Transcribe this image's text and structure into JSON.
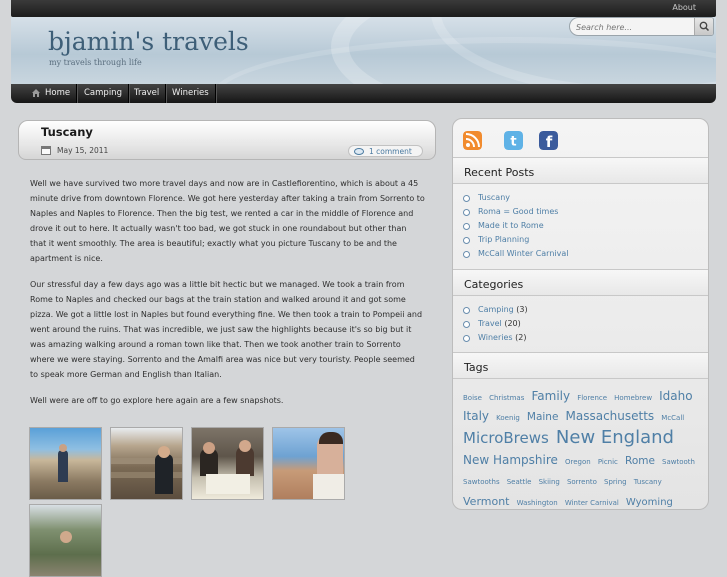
{
  "topbar": {
    "about": "About"
  },
  "header": {
    "title": "bjamin's travels",
    "tagline": "my travels through life"
  },
  "search": {
    "placeholder": "Search here..."
  },
  "nav": {
    "items": [
      "Home",
      "Camping",
      "Travel",
      "Wineries"
    ]
  },
  "post": {
    "title": "Tuscany",
    "date": "May 15, 2011",
    "comments": "1 comment",
    "paragraphs": [
      "Well we have survived two more travel days and now are in Castlefiorentino, which is about a 45 minute drive from downtown Florence. We got here yesterday after taking a train from Sorrento to Naples and Naples to Florence. Then the big test, we rented a car in the middle of Florence and drove it out to here. It actually wasn't too bad, we got stuck in one roundabout but other than that it went smoothly. The area is beautiful; exactly what you picture Tuscany to be and the apartment is nice.",
      "Our stressful day a few days ago was a little bit hectic but we managed. We took a train from Rome to Naples and checked our bags at the train station and walked around it and got some pizza. We got a little lost in Naples but found everything fine. We then took a train to Pompeii and went around the ruins. That was incredible, we just saw the highlights because it's so big but it was amazing walking around a roman town like that. Then we took another train to Sorrento where we were staying. Sorrento and the Amalfi area was nice but very touristy. People seemed to speak more German and English than Italian.",
      "Well were are off to go explore here again are a few snapshots."
    ]
  },
  "sidebar": {
    "social": [
      "rss-icon",
      "twitter-icon",
      "facebook-icon"
    ],
    "recent_title": "Recent Posts",
    "recent": [
      "Tuscany",
      "Roma = Good times",
      "Made it to Rome",
      "Trip Planning",
      "McCall Winter Carnival"
    ],
    "categories_title": "Categories",
    "categories": [
      {
        "name": "Camping",
        "count": "(3)"
      },
      {
        "name": "Travel",
        "count": "(20)"
      },
      {
        "name": "Wineries",
        "count": "(2)"
      }
    ],
    "tags_title": "Tags",
    "tags": [
      {
        "t": "Boise",
        "s": 7
      },
      {
        "t": "Christmas",
        "s": 7
      },
      {
        "t": "Family",
        "s": 12
      },
      {
        "t": "Florence",
        "s": 7
      },
      {
        "t": "Homebrew",
        "s": 7
      },
      {
        "t": "Idaho",
        "s": 12
      },
      {
        "t": "Italy",
        "s": 12
      },
      {
        "t": "Koenig",
        "s": 7
      },
      {
        "t": "Maine",
        "s": 10.5
      },
      {
        "t": "Massachusetts",
        "s": 12
      },
      {
        "t": "McCall",
        "s": 7
      },
      {
        "t": "MicroBrews",
        "s": 15
      },
      {
        "t": "New England",
        "s": 18
      },
      {
        "t": "New Hampshire",
        "s": 12
      },
      {
        "t": "Oregon",
        "s": 7
      },
      {
        "t": "Picnic",
        "s": 7
      },
      {
        "t": "Rome",
        "s": 10.5
      },
      {
        "t": "Sawtooth",
        "s": 7
      },
      {
        "t": "Sawtooths",
        "s": 7
      },
      {
        "t": "Seattle",
        "s": 7
      },
      {
        "t": "Skiing",
        "s": 7
      },
      {
        "t": "Sorrento",
        "s": 7
      },
      {
        "t": "Spring",
        "s": 7
      },
      {
        "t": "Tuscany",
        "s": 7
      },
      {
        "t": "Vermont",
        "s": 11
      },
      {
        "t": "Washington",
        "s": 7
      },
      {
        "t": "Winter Carnival",
        "s": 7
      },
      {
        "t": "Wyoming",
        "s": 10
      }
    ]
  },
  "colors": {
    "accent": "#4f7fa6",
    "nav": "#1c1c1c",
    "header": "#b7c9d6"
  }
}
